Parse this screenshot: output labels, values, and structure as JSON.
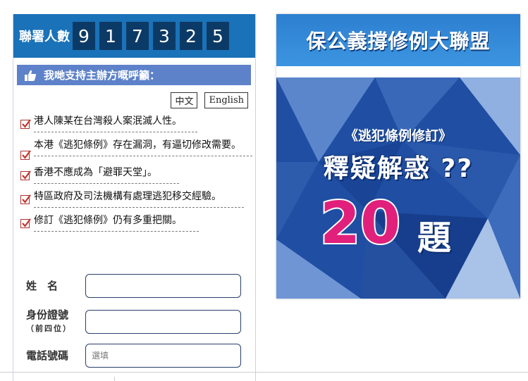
{
  "counter": {
    "label": "聯署人數",
    "digits": [
      "9",
      "1",
      "7",
      "3",
      "2",
      "5"
    ]
  },
  "support": {
    "icon": "thumbs-up-icon",
    "label": "我哋支持主辦方嘅呼籲："
  },
  "languages": {
    "zh": "中文",
    "en": "English"
  },
  "claims": [
    "港人陳某在台灣殺人案泯滅人性。",
    "本港《逃犯條例》存在漏洞，有逼切修改需要。",
    "香港不應成為「避罪天堂」。",
    "特區政府及司法機構有處理逃犯移交經驗。",
    "修訂《逃犯條例》仍有多重把關。"
  ],
  "form": {
    "name_label": "姓　名",
    "id_label": "身份證號",
    "id_sublabel": "（前四位）",
    "phone_label": "電話號碼",
    "phone_placeholder": "選填"
  },
  "banner": {
    "title": "保公義撐修例大聯盟",
    "subtitle": "《逃犯條例修訂》",
    "headline": "釋疑解惑 ??",
    "number": "20",
    "unit": "題"
  },
  "colors": {
    "counter_bg": "#1a72b8",
    "digit_bg": "#0c3a66",
    "support_bg": "#5d82c9",
    "banner_bg": "#1e4aa0",
    "accent_pink": "#e0207a"
  }
}
